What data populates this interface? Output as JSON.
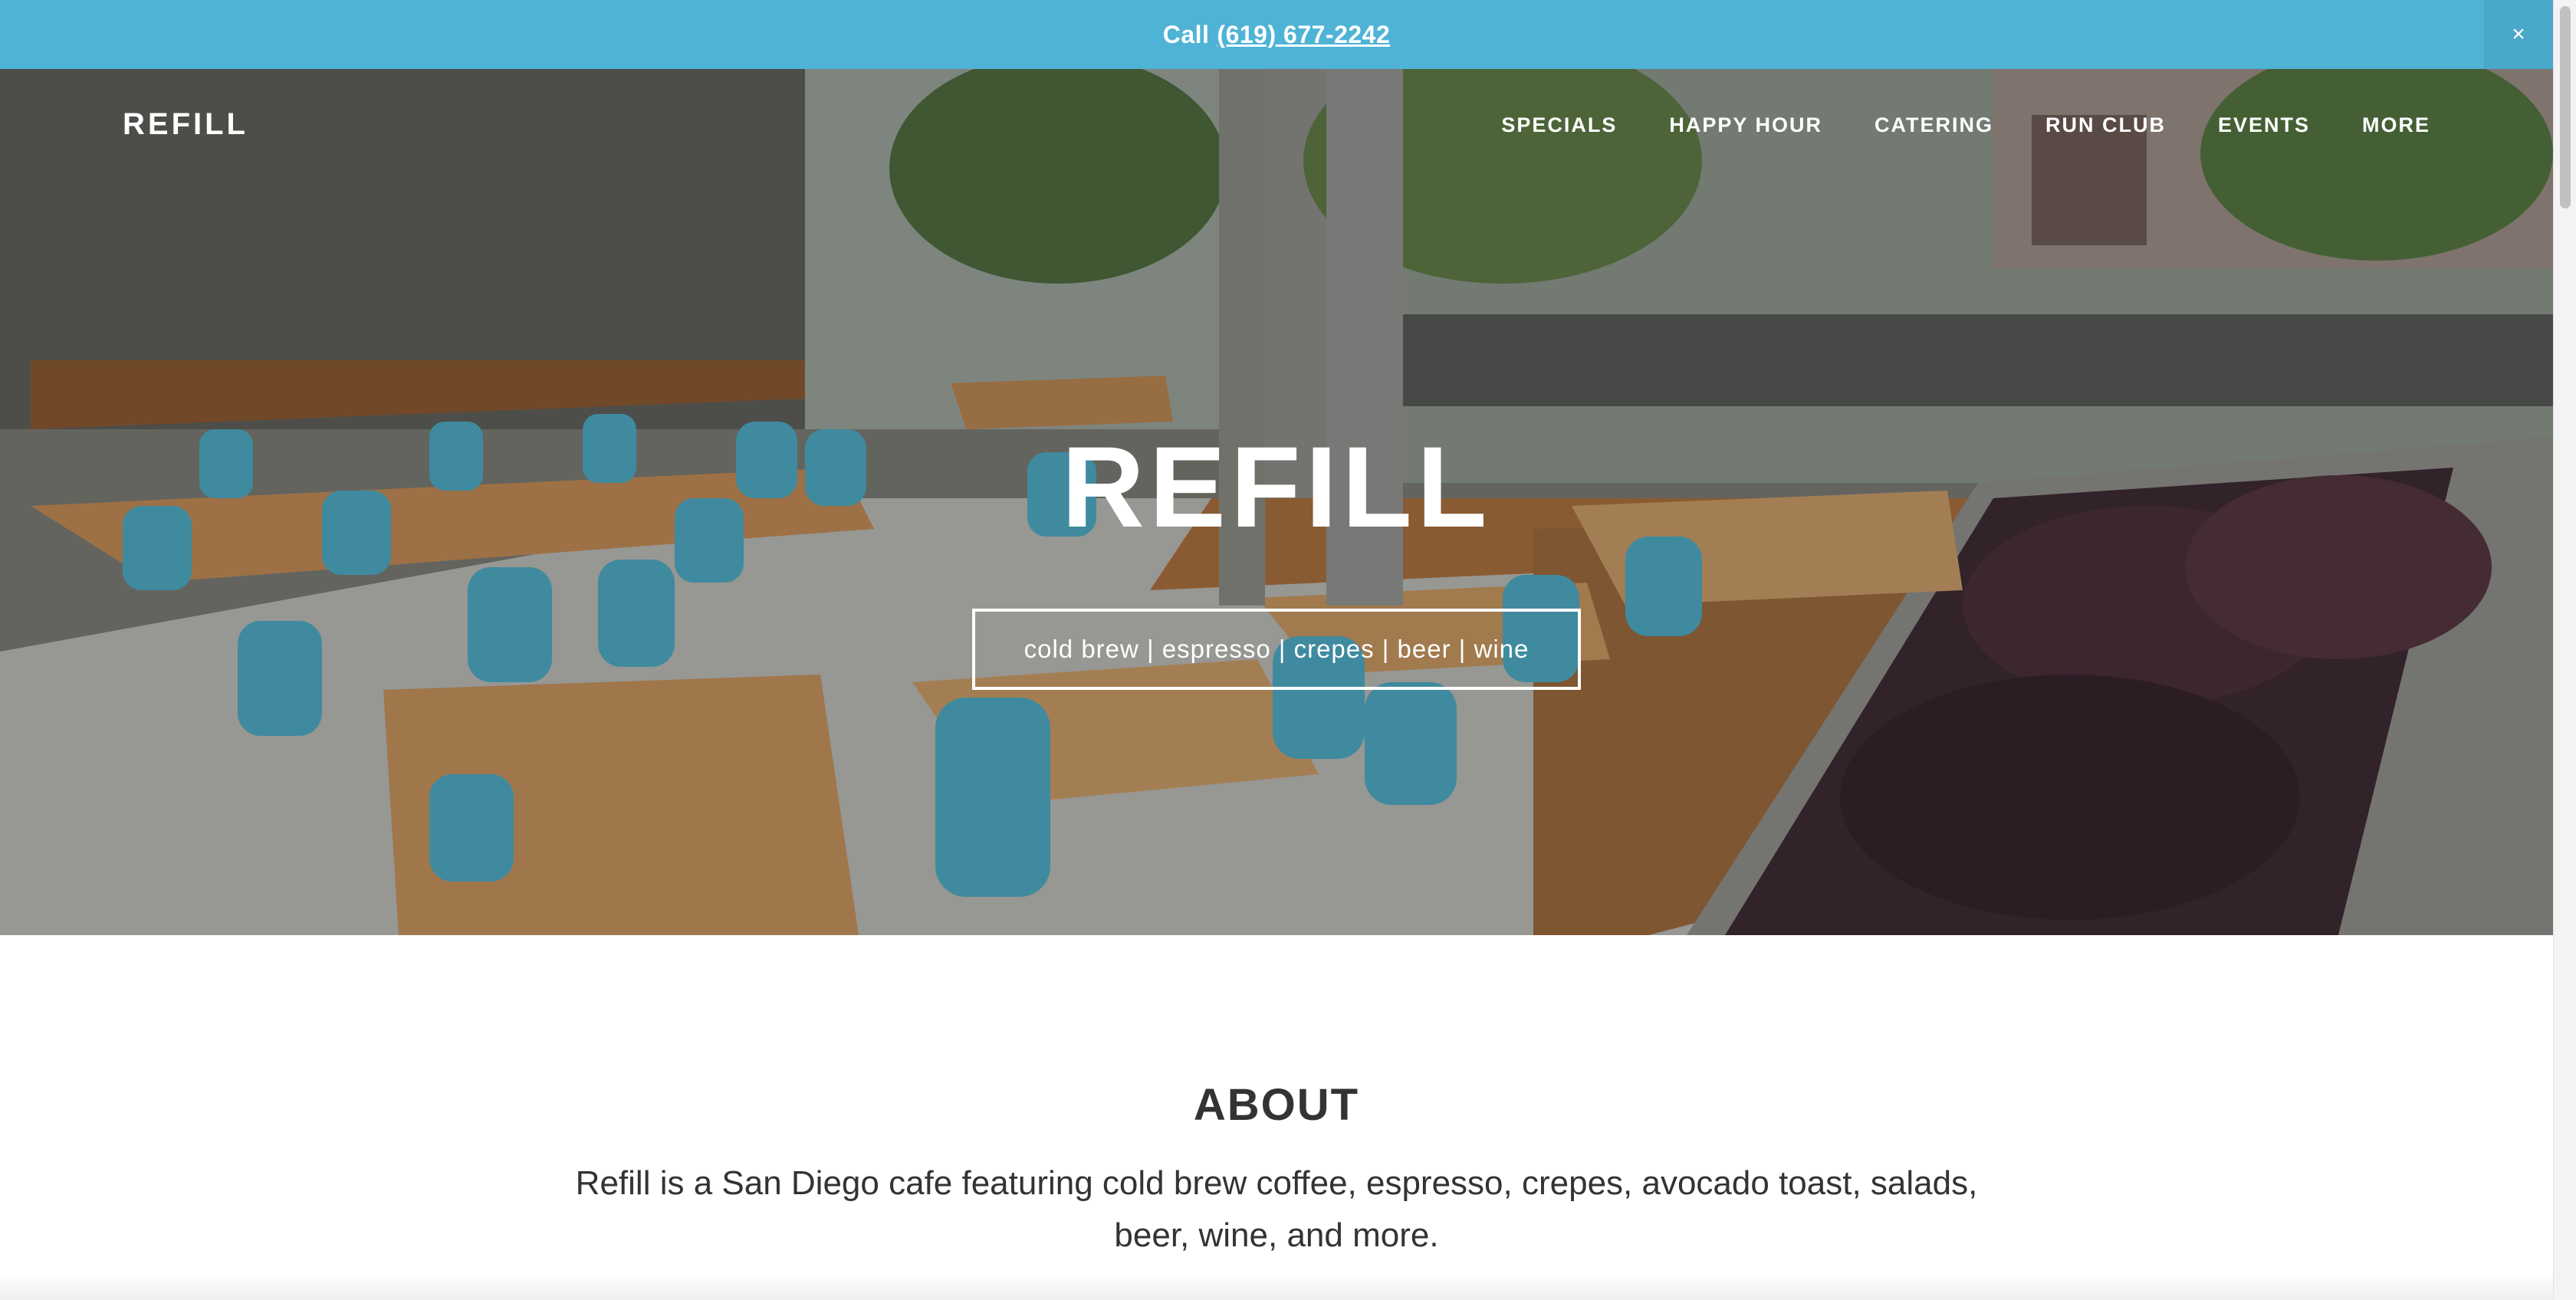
{
  "announcement": {
    "prefix": "Call",
    "phone": "(619) 677-2242",
    "close_glyph": "×"
  },
  "nav": {
    "logo": "REFILL",
    "items": [
      {
        "label": "SPECIALS"
      },
      {
        "label": "HAPPY HOUR"
      },
      {
        "label": "CATERING"
      },
      {
        "label": "RUN CLUB"
      },
      {
        "label": "EVENTS"
      },
      {
        "label": "MORE"
      }
    ]
  },
  "hero": {
    "title": "REFILL",
    "tagline": "cold brew | espresso | crepes | beer | wine"
  },
  "about": {
    "title": "ABOUT",
    "text": "Refill is a San Diego cafe featuring cold brew coffee, espresso, crepes, avocado toast, salads, beer, wine, and more."
  },
  "colors": {
    "announcement_bg": "#4fb3d6",
    "text_dark": "#333333",
    "chair_blue": "#4ea9c2",
    "table_wood": "#b7844f"
  },
  "icons": {
    "close": "close-icon"
  }
}
